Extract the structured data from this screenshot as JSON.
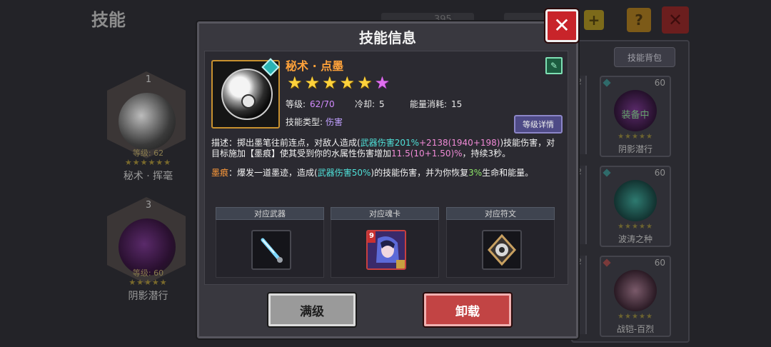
{
  "background": {
    "page_title": "技能",
    "equipped_skills": [
      {
        "slot": "1",
        "level_text": "等级: 62",
        "stars": "★★★★★★",
        "name": "秘术 · 挥毫"
      },
      {
        "slot": "3",
        "level_text": "等级: 60",
        "stars": "★★★★★",
        "name": "阴影潜行"
      }
    ],
    "bag_button": "技能背包",
    "bag_cards": [
      {
        "count": "60",
        "status": "装备中",
        "stars": "★★★★★",
        "name": "阴影潜行"
      },
      {
        "count": "60",
        "stars": "★★★★★",
        "name": "波涛之种"
      },
      {
        "count": "60",
        "stars": "★★★★★",
        "name": "战铠-百烈"
      }
    ],
    "partial_numbers": [
      "2",
      "2",
      "2"
    ],
    "currency_top": "395"
  },
  "dialog": {
    "title": "技能信息",
    "skill_name": "秘术 · 点墨",
    "stars_gold": 5,
    "stars_purple": 1,
    "level_label": "等级:",
    "level_value": "62/70",
    "cooldown_label": "冷却:",
    "cooldown_value": "5",
    "energy_label": "能量消耗:",
    "energy_value": "15",
    "type_label": "技能类型:",
    "type_value": "伤害",
    "level_detail_button": "等级详情",
    "desc": {
      "p1": "描述：掷出墨笔往前连点，对敌人造成(",
      "dmg1": "武器伤害201%",
      "dmg2": "+2138(1940+198)",
      "p2": ")技能伤害，对目标施加【墨痕】使其受到你的水属性伤害增加",
      "pct": "11.5(10+1.50)%",
      "p3": "，持续3秒。"
    },
    "mark": {
      "label": "墨痕",
      "p1": "：爆发一道墨迹，造成(",
      "dmg": "武器伤害50%",
      "p2": ")的技能伤害，并为你恢复",
      "heal": "3%",
      "p3": "生命和能量。"
    },
    "slots": [
      {
        "label": "对应武器",
        "icon": "weapon-icon"
      },
      {
        "label": "对应魂卡",
        "icon": "soul-card-icon"
      },
      {
        "label": "对应符文",
        "icon": "rune-icon"
      }
    ],
    "card_number": "9",
    "max_level_button": "满级",
    "unload_button": "卸载"
  },
  "colors": {
    "skill_name": "#ffa23a",
    "teal_value": "#4fe0d8",
    "pink_value": "#f08ad6",
    "unload_red": "#c24444",
    "close_red": "#c8242a"
  }
}
